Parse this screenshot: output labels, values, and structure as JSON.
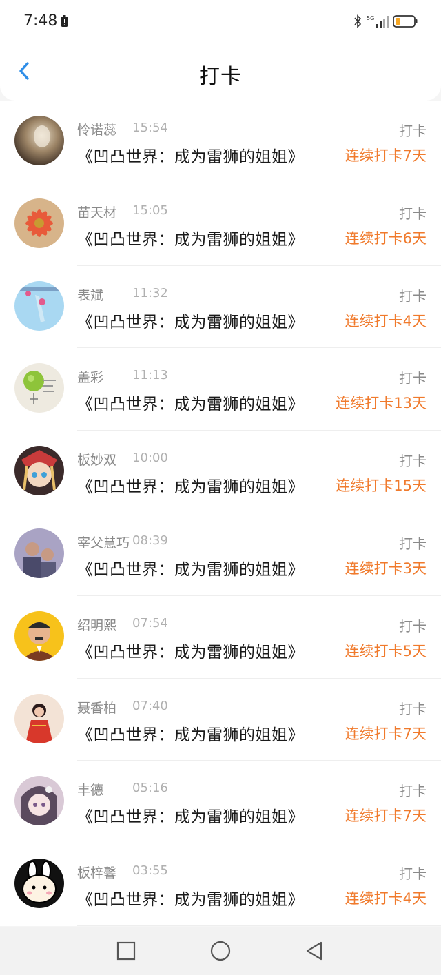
{
  "status_bar": {
    "time": "7:48",
    "network": "5G"
  },
  "header": {
    "title": "打卡"
  },
  "checkins": [
    {
      "username": "怜诺蕊",
      "time": "15:54",
      "book": "《凹凸世界：成为雷狮的姐姐》",
      "action": "打卡",
      "streak": "连续打卡7天",
      "avatar": "avatar-1"
    },
    {
      "username": "苗天材",
      "time": "15:05",
      "book": "《凹凸世界：成为雷狮的姐姐》",
      "action": "打卡",
      "streak": "连续打卡6天",
      "avatar": "avatar-2"
    },
    {
      "username": "表斌",
      "time": "11:32",
      "book": "《凹凸世界：成为雷狮的姐姐》",
      "action": "打卡",
      "streak": "连续打卡4天",
      "avatar": "avatar-3"
    },
    {
      "username": "盖彩",
      "time": "11:13",
      "book": "《凹凸世界：成为雷狮的姐姐》",
      "action": "打卡",
      "streak": "连续打卡13天",
      "avatar": "avatar-4"
    },
    {
      "username": "板妙双",
      "time": "10:00",
      "book": "《凹凸世界：成为雷狮的姐姐》",
      "action": "打卡",
      "streak": "连续打卡15天",
      "avatar": "avatar-5"
    },
    {
      "username": "宰父慧巧",
      "time": "08:39",
      "book": "《凹凸世界：成为雷狮的姐姐》",
      "action": "打卡",
      "streak": "连续打卡3天",
      "avatar": "avatar-6"
    },
    {
      "username": "绍明熙",
      "time": "07:54",
      "book": "《凹凸世界：成为雷狮的姐姐》",
      "action": "打卡",
      "streak": "连续打卡5天",
      "avatar": "avatar-7"
    },
    {
      "username": "聂香柏",
      "time": "07:40",
      "book": "《凹凸世界：成为雷狮的姐姐》",
      "action": "打卡",
      "streak": "连续打卡7天",
      "avatar": "avatar-8"
    },
    {
      "username": "丰德",
      "time": "05:16",
      "book": "《凹凸世界：成为雷狮的姐姐》",
      "action": "打卡",
      "streak": "连续打卡7天",
      "avatar": "avatar-9"
    },
    {
      "username": "板梓馨",
      "time": "03:55",
      "book": "《凹凸世界：成为雷狮的姐姐》",
      "action": "打卡",
      "streak": "连续打卡4天",
      "avatar": "avatar-10"
    }
  ],
  "colors": {
    "accent": "#f07a2c",
    "back": "#2f8ee8",
    "background": "#f5f5f5"
  },
  "icons": {
    "back": "back-arrow-icon",
    "nav_recent": "square-icon",
    "nav_home": "circle-icon",
    "nav_back": "triangle-icon"
  }
}
